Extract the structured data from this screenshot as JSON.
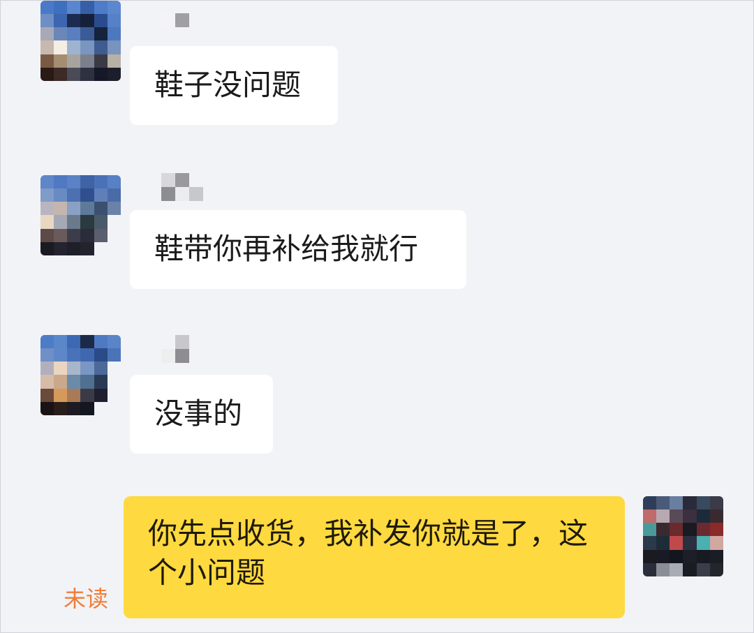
{
  "messages": [
    {
      "sender": "other",
      "text": "鞋子没问题"
    },
    {
      "sender": "other",
      "text": "鞋带你再补给我就行"
    },
    {
      "sender": "other",
      "text": "没事的"
    },
    {
      "sender": "self",
      "text": "你先点收货，我补发你就是了，这个小问题",
      "status": "未读"
    }
  ],
  "icons": {
    "avatar_other": "pixelated-avatar-icon",
    "avatar_self": "pixelated-avatar-icon"
  }
}
